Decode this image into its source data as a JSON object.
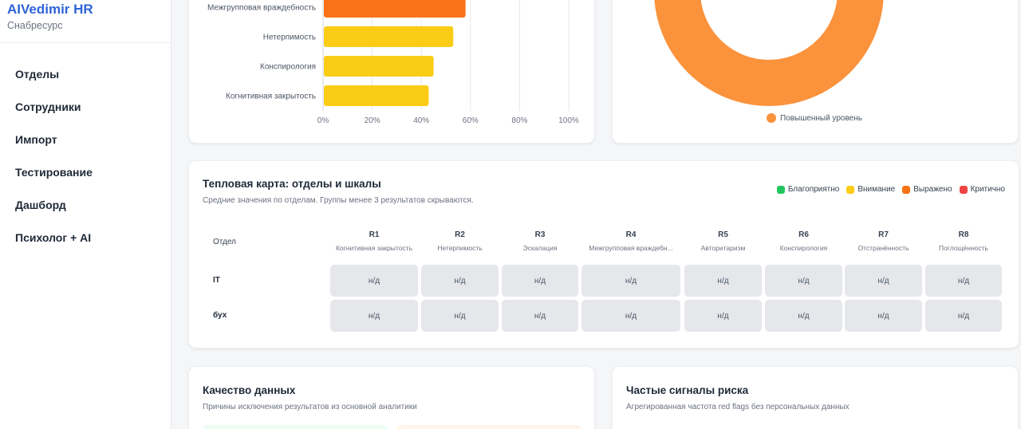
{
  "brand": {
    "title": "AIVedimir HR",
    "subtitle": "Снабресурс"
  },
  "nav": [
    {
      "label": "Отделы"
    },
    {
      "label": "Сотрудники"
    },
    {
      "label": "Импорт"
    },
    {
      "label": "Тестирование"
    },
    {
      "label": "Дашборд"
    },
    {
      "label": "Психолог + AI"
    }
  ],
  "chart_data": [
    {
      "type": "bar",
      "orientation": "horizontal",
      "categories": [
        "Межгрупповая враждебность",
        "Нетерпимость",
        "Конспирология",
        "Когнитивная закрытость"
      ],
      "values": [
        58,
        53,
        45,
        43
      ],
      "colors": [
        "#f97316",
        "#facc15",
        "#facc15",
        "#facc15"
      ],
      "xlim": [
        0,
        100
      ],
      "xticks": [
        "0%",
        "20%",
        "40%",
        "60%",
        "80%",
        "100%"
      ],
      "grid": true
    },
    {
      "type": "pie",
      "variant": "donut",
      "slices": [
        {
          "name": "Повышенный уровень",
          "value": 100,
          "color": "#fb923c"
        }
      ],
      "legend": "bottom"
    }
  ],
  "heatmap": {
    "title": "Тепловая карта: отделы и шкалы",
    "subtitle": "Средние значения по отделам. Группы менее 3 результатов скрываются.",
    "legend": [
      {
        "label": "Благоприятно",
        "color": "#22c55e"
      },
      {
        "label": "Внимание",
        "color": "#facc15"
      },
      {
        "label": "Выражено",
        "color": "#f97316"
      },
      {
        "label": "Критично",
        "color": "#ef4444"
      }
    ],
    "dept_header": "Отдел",
    "columns": [
      {
        "code": "R1",
        "name": "Когнитивная закрытость"
      },
      {
        "code": "R2",
        "name": "Нетерпимость"
      },
      {
        "code": "R3",
        "name": "Эскалация"
      },
      {
        "code": "R4",
        "name": "Межгрупповая враждебн..."
      },
      {
        "code": "R5",
        "name": "Авторитаризм"
      },
      {
        "code": "R6",
        "name": "Конспирология"
      },
      {
        "code": "R7",
        "name": "Отстранённость"
      },
      {
        "code": "R8",
        "name": "Поглощённость"
      }
    ],
    "rows": [
      {
        "dept": "IT",
        "values": [
          "н/д",
          "н/д",
          "н/д",
          "н/д",
          "н/д",
          "н/д",
          "н/д",
          "н/д"
        ]
      },
      {
        "dept": "бух",
        "values": [
          "н/д",
          "н/д",
          "н/д",
          "н/д",
          "н/д",
          "н/д",
          "н/д",
          "н/д"
        ]
      }
    ]
  },
  "quality": {
    "title": "Качество данных",
    "subtitle": "Причины исключения результатов из основной аналитики"
  },
  "signals": {
    "title": "Частые сигналы риска",
    "subtitle": "Агрегированная частота red flags без персональных данных"
  }
}
